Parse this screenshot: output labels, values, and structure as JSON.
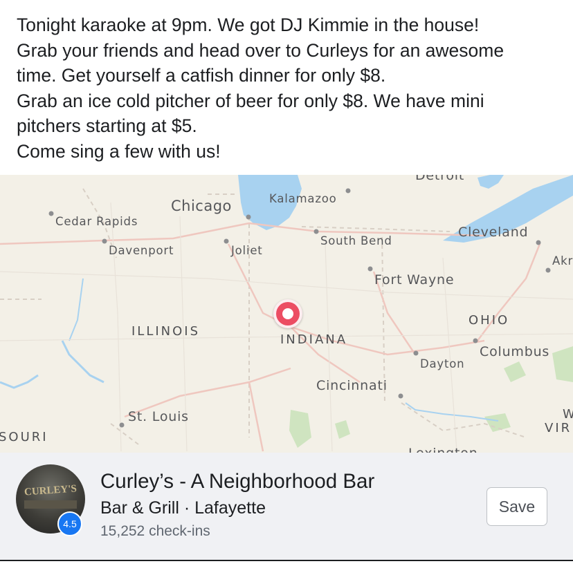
{
  "post": {
    "lines": [
      "Tonight karaoke at 9pm.  We got DJ Kimmie in the house!",
      "Grab your friends and head over to Curleys for an awesome",
      "time. Get yourself a catfish dinner for only $8.",
      "Grab an ice cold pitcher of beer for only $8. We have mini",
      "pitchers starting at $5.",
      "Come sing a few with us!"
    ]
  },
  "map": {
    "cities": {
      "detroit": "Detroit",
      "chicago": "Chicago",
      "kalamazoo": "Kalamazoo",
      "cedar_rapids": "Cedar Rapids",
      "south_bend": "South Bend",
      "cleveland": "Cleveland",
      "davenport": "Davenport",
      "joliet": "Joliet",
      "akron": "Akr",
      "fort_wayne": "Fort Wayne",
      "columbus": "Columbus",
      "dayton": "Dayton",
      "cincinnati": "Cincinnati",
      "st_louis": "St. Louis",
      "lexington": "Lexington"
    },
    "states": {
      "illinois": "ILLINOIS",
      "indiana": "INDIANA",
      "ohio": "OHIO",
      "missouri": "SOURI",
      "west_virginia_1": "W",
      "west_virginia_2": "VIR"
    },
    "colors": {
      "land": "#f3f0e7",
      "water": "#a8d2f0",
      "park": "#cfe4c0",
      "pin": "#ec4d63",
      "road": "#f2b8b0"
    }
  },
  "card": {
    "name": "Curley’s - A Neighborhood Bar",
    "category": "Bar & Grill · Lafayette",
    "checkins": "15,252 check-ins",
    "rating": "4.5",
    "logo_text": "CURLEY'S",
    "save_label": "Save",
    "colors": {
      "rating_badge": "#1877f2",
      "background": "#f0f1f4"
    }
  }
}
